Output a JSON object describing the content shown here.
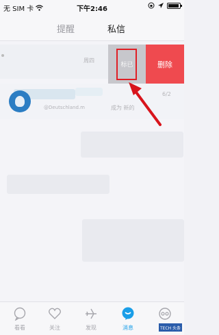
{
  "status_bar": {
    "carrier": "无 SIM 卡",
    "time": "下午2:46"
  },
  "tabs": [
    {
      "label": "提醒",
      "active": false
    },
    {
      "label": "私信",
      "active": true
    }
  ],
  "conversation_1": {
    "date": "周四",
    "actions": {
      "mark_read": "标已",
      "delete": "删除"
    }
  },
  "conversation_2": {
    "subtitle": "@Deutschland.m",
    "action_text": "成为 新的",
    "date": "6/2"
  },
  "bottom_nav": [
    {
      "label": "看看",
      "icon": "chat-bubble-icon",
      "active": false
    },
    {
      "label": "关注",
      "icon": "heart-icon",
      "active": false
    },
    {
      "label": "发现",
      "icon": "plane-icon",
      "active": false
    },
    {
      "label": "消息",
      "icon": "message-icon",
      "active": true
    },
    {
      "label": "",
      "icon": "glasses-icon",
      "active": false
    }
  ],
  "watermark": "TECH 头条",
  "colors": {
    "accent": "#1a9ee8",
    "delete": "#ef4a4f",
    "highlight": "#e01e25"
  }
}
